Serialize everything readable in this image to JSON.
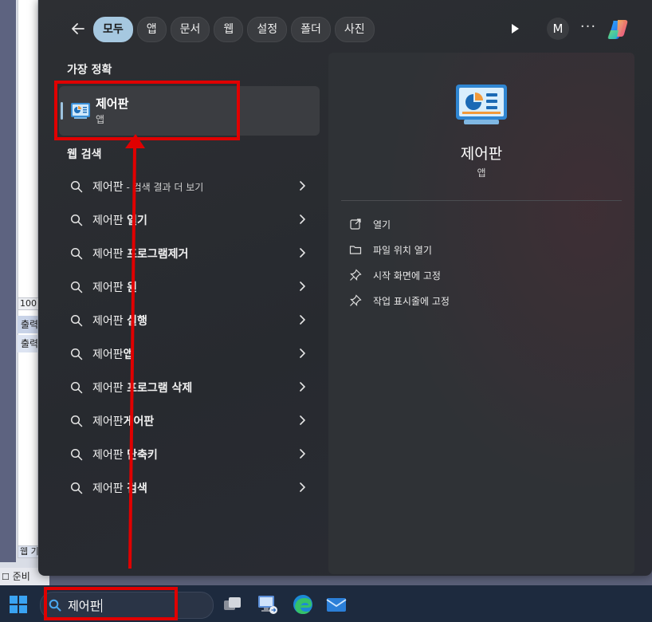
{
  "background_app": {
    "zoom_cell": "100 %",
    "output_row_1": "출력",
    "output_row_2": "출력",
    "sheet_tab": "웹 기",
    "status_ready": "준비"
  },
  "topbar": {
    "filters": [
      {
        "label": "모두",
        "active": true
      },
      {
        "label": "앱",
        "active": false
      },
      {
        "label": "문서",
        "active": false
      },
      {
        "label": "웹",
        "active": false
      },
      {
        "label": "설정",
        "active": false
      },
      {
        "label": "폴더",
        "active": false
      },
      {
        "label": "사진",
        "active": false
      }
    ],
    "avatar_initial": "M",
    "more_label": "···"
  },
  "best_match": {
    "section_title": "가장 정확",
    "name": "제어판",
    "type": "앱"
  },
  "web_search": {
    "section_title": "웹 검색",
    "items": [
      {
        "base": "제어판",
        "bold": "",
        "suffix": " - 검색 결과 더 보기"
      },
      {
        "base": "제어판 ",
        "bold": "열기",
        "suffix": ""
      },
      {
        "base": "제어판 ",
        "bold": "프로그램제거",
        "suffix": ""
      },
      {
        "base": "제어판 ",
        "bold": "윈",
        "suffix": ""
      },
      {
        "base": "제어판 ",
        "bold": "실행",
        "suffix": ""
      },
      {
        "base": "제어판",
        "bold": "앱",
        "suffix": ""
      },
      {
        "base": "제어판 ",
        "bold": "프로그램 삭제",
        "suffix": ""
      },
      {
        "base": "제어판",
        "bold": "게어판",
        "suffix": ""
      },
      {
        "base": "제어판 ",
        "bold": "단축키",
        "suffix": ""
      },
      {
        "base": "제어판 ",
        "bold": "검색",
        "suffix": ""
      }
    ]
  },
  "preview": {
    "title": "제어판",
    "type": "앱",
    "actions": [
      {
        "label": "열기",
        "icon": "open-icon"
      },
      {
        "label": "파일 위치 열기",
        "icon": "folder-icon"
      },
      {
        "label": "시작 화면에 고정",
        "icon": "pin-icon"
      },
      {
        "label": "작업 표시줄에 고정",
        "icon": "pin-icon"
      }
    ]
  },
  "taskbar": {
    "search_query": "제어판"
  },
  "colors": {
    "accent": "#a6c8e0",
    "annotation_red": "#e00000",
    "taskbar": "#1d2a3e"
  }
}
